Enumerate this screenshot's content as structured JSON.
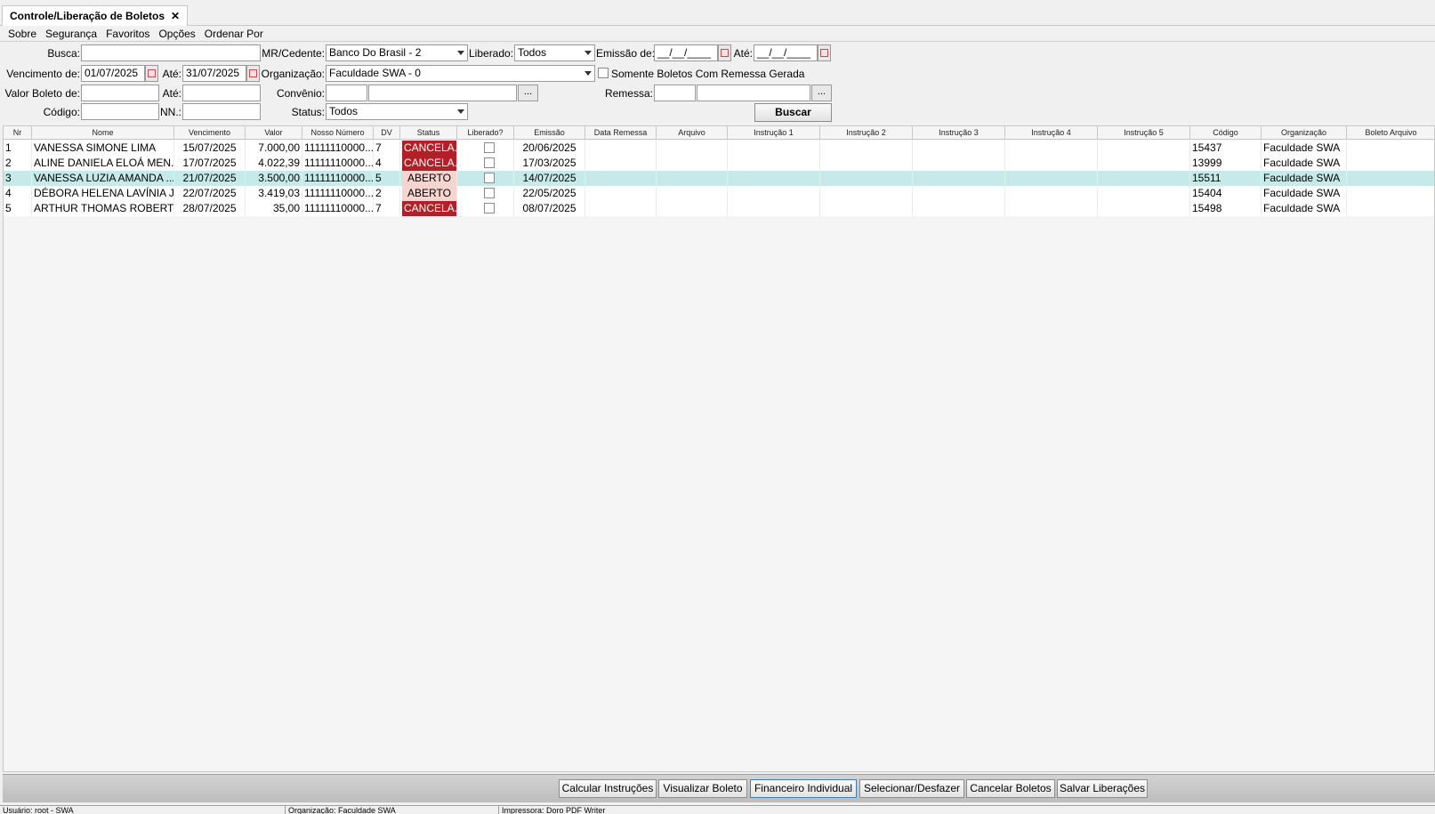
{
  "tab": {
    "title": "Controle/Liberação de Boletos",
    "close": "✕"
  },
  "menu": [
    "Sobre",
    "Segurança",
    "Favoritos",
    "Opções",
    "Ordenar Por"
  ],
  "filters": {
    "busca_label": "Busca:",
    "busca_value": "",
    "mr_label": "MR/Cedente:",
    "mr_value": "Banco Do Brasil - 2",
    "liberado_label": "Liberado:",
    "liberado_value": "Todos",
    "emissao_label": "Emissão de:",
    "emissao_de": "__/__/____",
    "ate_label": "Até:",
    "emissao_ate": "__/__/____",
    "vencimento_label": "Vencimento de:",
    "vencimento_de": "01/07/2025",
    "vencimento_ate": "31/07/2025",
    "organizacao_label": "Organização:",
    "organizacao_value": "Faculdade SWA - 0",
    "somente_label": "Somente Boletos Com Remessa Gerada",
    "valor_label": "Valor Boleto de:",
    "convenio_label": "Convênio:",
    "remessa_label": "Remessa:",
    "codigo_label": "Código:",
    "nn_label": "NN.:",
    "status_label": "Status:",
    "status_value": "Todos",
    "dots": "...",
    "buscar": "Buscar"
  },
  "table": {
    "headers": [
      "Nr",
      "Nome",
      "Vencimento",
      "Valor",
      "Nosso Número",
      "DV",
      "Status",
      "Liberado?",
      "Emissão",
      "Data Remessa",
      "Arquivo",
      "Instrução 1",
      "Instrução 2",
      "Instrução 3",
      "Instrução 4",
      "Instrução 5",
      "Código",
      "Organização",
      "Boleto Arquivo"
    ],
    "rows": [
      {
        "nr": "1",
        "nome": "VANESSA SIMONE LIMA",
        "venc": "15/07/2025",
        "valor": "7.000,00",
        "nn": "11111110000...",
        "dv": "7",
        "status": "CANCELA...",
        "status_type": "cancel",
        "emissao": "20/06/2025",
        "codigo": "15437",
        "org": "Faculdade SWA"
      },
      {
        "nr": "2",
        "nome": "ALINE DANIELA ELOÁ MEN...",
        "venc": "17/07/2025",
        "valor": "4.022,39",
        "nn": "11111110000...",
        "dv": "4",
        "status": "CANCELA...",
        "status_type": "cancel",
        "emissao": "17/03/2025",
        "codigo": "13999",
        "org": "Faculdade SWA"
      },
      {
        "nr": "3",
        "nome": "VANESSA LUZIA AMANDA ...",
        "venc": "21/07/2025",
        "valor": "3.500,00",
        "nn": "11111110000...",
        "dv": "5",
        "status": "ABERTO",
        "status_type": "open",
        "emissao": "14/07/2025",
        "codigo": "15511",
        "org": "Faculdade SWA"
      },
      {
        "nr": "4",
        "nome": "DÉBORA HELENA LAVÍNIA J...",
        "venc": "22/07/2025",
        "valor": "3.419,03",
        "nn": "11111110000...",
        "dv": "2",
        "status": "ABERTO",
        "status_type": "open",
        "emissao": "22/05/2025",
        "codigo": "15404",
        "org": "Faculdade SWA"
      },
      {
        "nr": "5",
        "nome": "ARTHUR THOMAS ROBERT...",
        "venc": "28/07/2025",
        "valor": "35,00",
        "nn": "11111110000...",
        "dv": "7",
        "status": "CANCELA...",
        "status_type": "cancel",
        "emissao": "08/07/2025",
        "codigo": "15498",
        "org": "Faculdade SWA"
      }
    ]
  },
  "buttons": [
    "Calcular Instruções",
    "Visualizar Boleto",
    "Financeiro Individual",
    "Selecionar/Desfazer",
    "Cancelar Boletos",
    "Salvar Liberações"
  ],
  "statusbar": [
    "Usuário: root - SWA",
    "Organização: Faculdade SWA",
    "Impressora: Doro PDF Writer"
  ],
  "colors": {
    "cancel": "#b02127",
    "open": "#f6d4d0",
    "selected_row": "#c6e9e9"
  }
}
